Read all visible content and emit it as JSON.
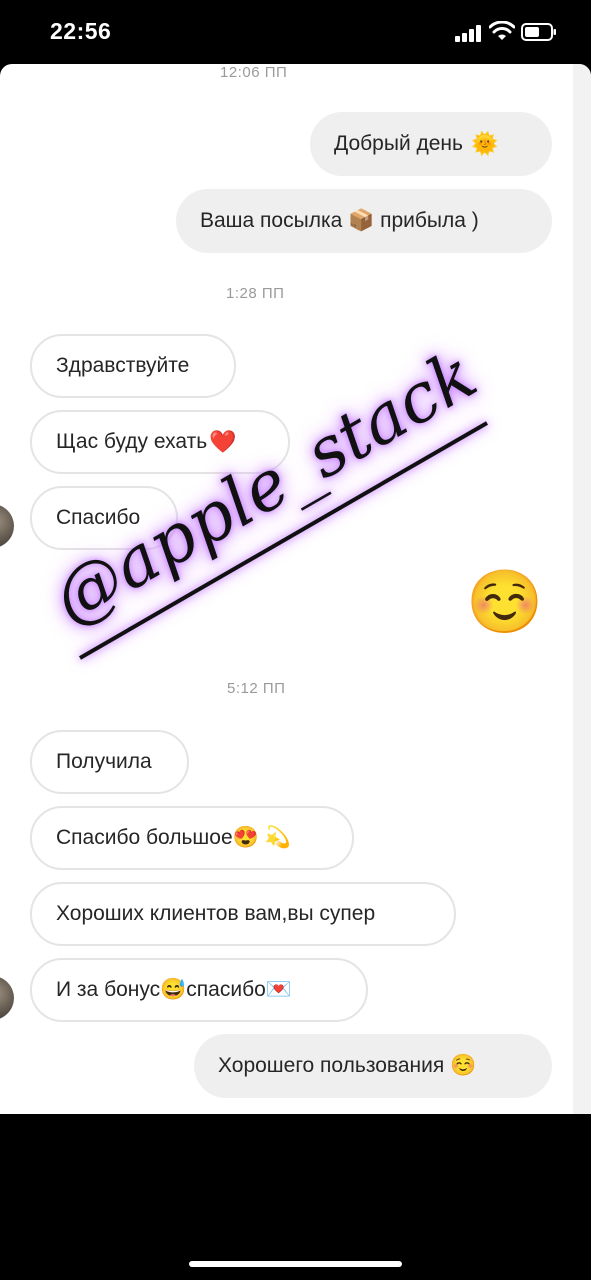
{
  "status_bar": {
    "time": "22:56"
  },
  "messages": {
    "time_1": "12:06 ПП",
    "out_1": "Добрый день",
    "out_1_emoji": "🌞",
    "out_2": "Ваша посылка 📦 прибыла )",
    "time_2": "1:28 ПП",
    "in_1": "Здравствуйте",
    "in_2": "Щас буду ехать",
    "in_2_emoji": "❤️",
    "in_3": "Спасибо",
    "reaction_emoji": "☺️",
    "time_3": "5:12 ПП",
    "in_4": "Получила",
    "in_5": "Спасибо большое😍 💫",
    "in_6": "Хороших клиентов вам,вы супер",
    "in_7": "И за бонус😅спасибо💌",
    "out_3": "Хорошего пользования ☺️"
  },
  "watermark": "@apple_stack"
}
